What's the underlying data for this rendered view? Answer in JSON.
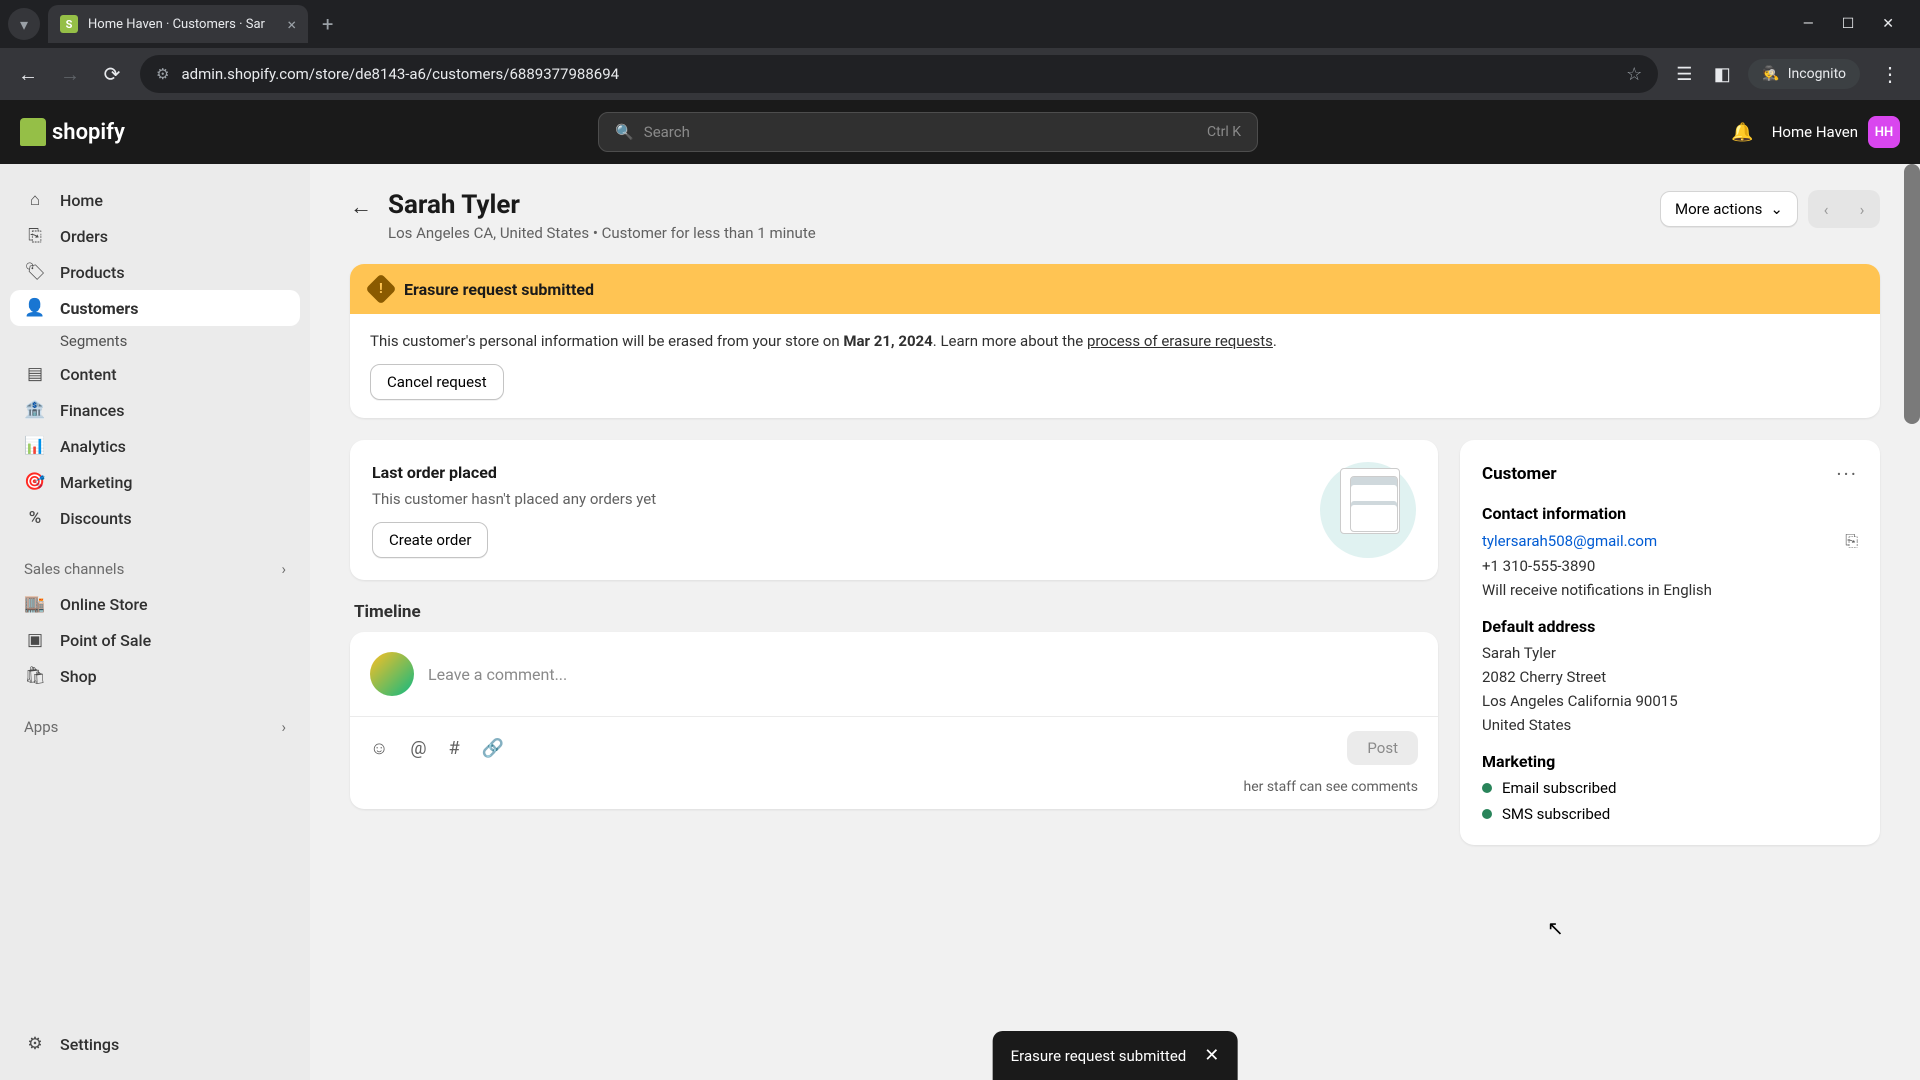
{
  "browser": {
    "tab_title": "Home Haven · Customers · Sar",
    "url": "admin.shopify.com/store/de8143-a6/customers/6889377988694",
    "incognito_label": "Incognito"
  },
  "header": {
    "logo_text": "shopify",
    "search_placeholder": "Search",
    "search_shortcut": "Ctrl K",
    "store_name": "Home Haven",
    "store_initials": "HH"
  },
  "sidebar": {
    "items": [
      {
        "icon": "⌂",
        "label": "Home"
      },
      {
        "icon": "⌸",
        "label": "Orders"
      },
      {
        "icon": "⊞",
        "label": "Products"
      },
      {
        "icon": "☺",
        "label": "Customers",
        "active": true
      },
      {
        "icon": "▤",
        "label": "Content"
      },
      {
        "icon": "≡",
        "label": "Finances"
      },
      {
        "icon": "⫾",
        "label": "Analytics"
      },
      {
        "icon": "◎",
        "label": "Marketing"
      },
      {
        "icon": "%",
        "label": "Discounts"
      }
    ],
    "segments_label": "Segments",
    "sales_channels_label": "Sales channels",
    "channels": [
      {
        "icon": "⌂",
        "label": "Online Store"
      },
      {
        "icon": "▣",
        "label": "Point of Sale"
      },
      {
        "icon": "▢",
        "label": "Shop"
      }
    ],
    "apps_label": "Apps",
    "settings_label": "Settings"
  },
  "page": {
    "title": "Sarah Tyler",
    "subtitle": "Los Angeles CA, United States • Customer for less than 1 minute",
    "more_actions": "More actions"
  },
  "banner": {
    "title": "Erasure request submitted",
    "body_prefix": "This customer's personal information will be erased from your store on ",
    "body_date": "Mar 21, 2024",
    "body_suffix": ". Learn more about the ",
    "link_text": "process of erasure requests",
    "body_end": ".",
    "cancel_label": "Cancel request"
  },
  "order_card": {
    "title": "Last order placed",
    "text": "This customer hasn't placed any orders yet",
    "create_label": "Create order"
  },
  "timeline": {
    "title": "Timeline",
    "placeholder": "Leave a comment...",
    "post_label": "Post",
    "note_suffix": "her staff can see comments"
  },
  "customer_panel": {
    "title": "Customer",
    "contact_title": "Contact information",
    "email": "tylersarah508@gmail.com",
    "phone": "+1 310-555-3890",
    "lang_note": "Will receive notifications in English",
    "address_title": "Default address",
    "address": {
      "name": "Sarah Tyler",
      "street": "2082 Cherry Street",
      "city": "Los Angeles California 90015",
      "country": "United States"
    },
    "marketing_title": "Marketing",
    "email_status": "Email subscribed",
    "sms_status": "SMS subscribed"
  },
  "toast": {
    "message": "Erasure request submitted"
  }
}
